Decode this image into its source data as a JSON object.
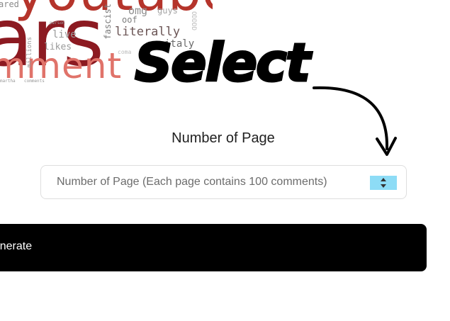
{
  "word_cloud": {
    "big_words": [
      "youtube",
      "ars",
      "omment"
    ],
    "small_words": {
      "omg": "omg",
      "guys": "guys",
      "literally": "literally",
      "live": "live",
      "ared": "ared",
      "likes": "likes",
      "italy": "italy",
      "oof": "oof",
      "person": "person",
      "fascist": "fascist",
      "millions": "millions",
      "box": "ODDDD",
      "coma": "coma",
      "ear": "ear",
      "comments": "comments",
      "martha": "martha"
    },
    "colors": {
      "dark_red": "#8c1a21",
      "red": "#b5342b",
      "salmon": "#e0736a"
    }
  },
  "annotation": {
    "text": "Select",
    "arrow": "curved-down-arrow"
  },
  "form": {
    "label": "Number of Page",
    "input_placeholder": "Number of Page (Each page contains 100 comments)",
    "spinner_color": "#8ddcf6"
  },
  "actions": {
    "generate_label": "enerate"
  }
}
